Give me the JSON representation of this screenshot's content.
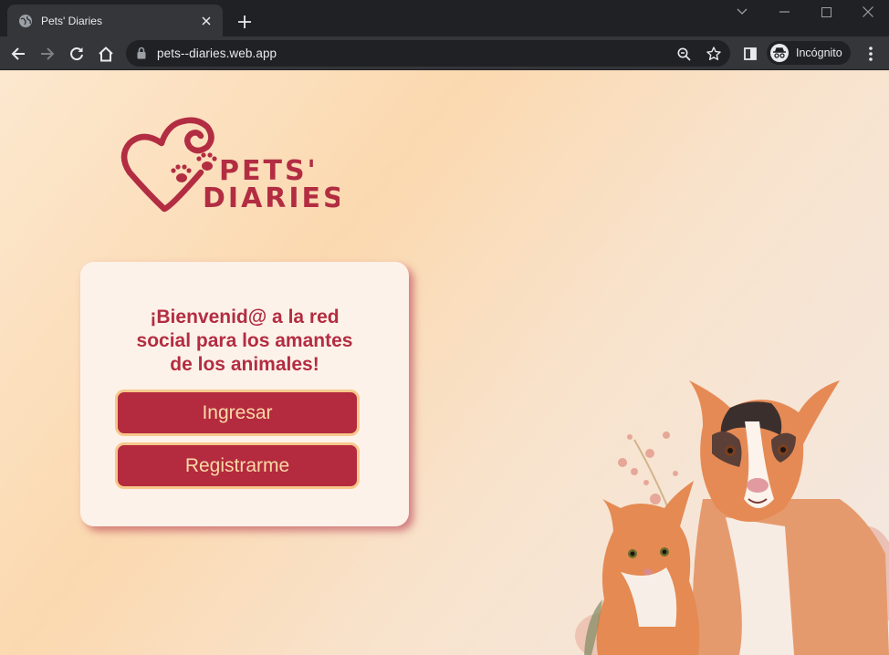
{
  "browser": {
    "tab_title": "Pets' Diaries",
    "url": "pets--diaries.web.app",
    "profile_label": "Incógnito"
  },
  "icons": {
    "tab_favicon": "globe-icon",
    "tab_close": "close-icon",
    "new_tab": "plus-icon",
    "back": "arrow-left-icon",
    "forward": "arrow-right-icon",
    "reload": "reload-icon",
    "home": "home-icon",
    "site_info": "lock-icon",
    "zoom": "zoom-icon",
    "bookmark": "star-icon",
    "side_panel": "side-panel-icon",
    "profile": "incognito-icon",
    "menu": "kebab-menu-icon"
  },
  "page": {
    "logo_text_line1": "PETS'",
    "logo_text_line2": "DIARIES",
    "welcome": "¡Bienvenid@ a la red social para los amantes de los animales!",
    "login_button": "Ingresar",
    "register_button": "Registrarme"
  },
  "colors": {
    "brand_red": "#b42a3f",
    "button_border": "#f7c88c",
    "button_text": "#fbd9a5",
    "card_bg": "#fdf2e9"
  }
}
